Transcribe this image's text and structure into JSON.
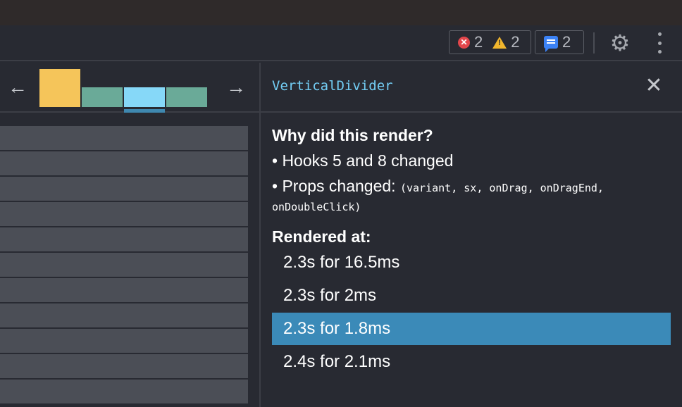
{
  "toolbar": {
    "errors": {
      "icon": "error-circle-icon",
      "count": "2"
    },
    "warnings": {
      "icon": "warning-triangle-icon",
      "count": "2"
    },
    "messages": {
      "icon": "message-icon",
      "count": "2"
    },
    "settings_icon": "gear-icon",
    "more_icon": "kebab-menu-icon"
  },
  "commit_nav": {
    "prev_icon": "arrow-left-icon",
    "next_icon": "arrow-right-icon",
    "prev_glyph": "←",
    "next_glyph": "→",
    "commits": [
      {
        "color": "#f5c55a",
        "relative_height": 1.0
      },
      {
        "color": "#6aaa98",
        "relative_height": 0.52
      },
      {
        "color": "#86d8f8",
        "relative_height": 0.52,
        "selected": true
      },
      {
        "color": "#6aaa98",
        "relative_height": 0.52
      }
    ]
  },
  "sidebar": {
    "component_name": "VerticalDivider",
    "close_icon": "close-icon",
    "close_glyph": "✕",
    "why_title": "Why did this render?",
    "reasons": [
      {
        "text": "• Hooks 5 and 8 changed"
      },
      {
        "text": "• Props changed: ",
        "props_part1": "(variant, sx, onDrag, onDragEnd,",
        "props_part2": "onDoubleClick)"
      }
    ],
    "rendered_at_title": "Rendered at:",
    "renders": [
      {
        "label": "2.3s for 16.5ms",
        "selected": false
      },
      {
        "label": "2.3s for 2ms",
        "selected": false
      },
      {
        "label": "2.3s for 1.8ms",
        "selected": true
      },
      {
        "label": "2.4s for 2.1ms",
        "selected": false
      }
    ]
  },
  "colors": {
    "accent_selected": "#3b8ab8",
    "component_name": "#73cef5"
  }
}
